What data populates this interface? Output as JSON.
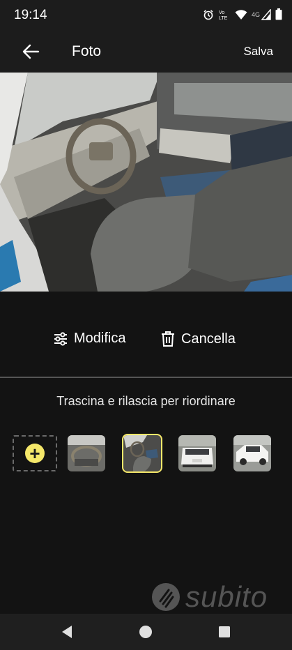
{
  "status_bar": {
    "time": "19:14",
    "icons": [
      "alarm-icon",
      "volte-icon",
      "wifi-icon",
      "signal-4g-icon",
      "battery-icon"
    ],
    "network_label": "4G"
  },
  "app_bar": {
    "back_icon": "arrow-left-icon",
    "title": "Foto",
    "save_label": "Salva"
  },
  "actions": {
    "edit_label": "Modifica",
    "edit_icon": "sliders-icon",
    "delete_label": "Cancella",
    "delete_icon": "trash-icon"
  },
  "reorder_hint": "Trascina e rilascia per riordinare",
  "thumbnails": [
    {
      "name": "thumb-dashboard",
      "selected": false
    },
    {
      "name": "thumb-interior",
      "selected": true
    },
    {
      "name": "thumb-front",
      "selected": false
    },
    {
      "name": "thumb-side",
      "selected": false
    }
  ],
  "add_button_icon": "plus-icon",
  "watermark": "subito",
  "colors": {
    "accent": "#f5e86a",
    "background": "#131313",
    "bar": "#1c1c1c"
  }
}
